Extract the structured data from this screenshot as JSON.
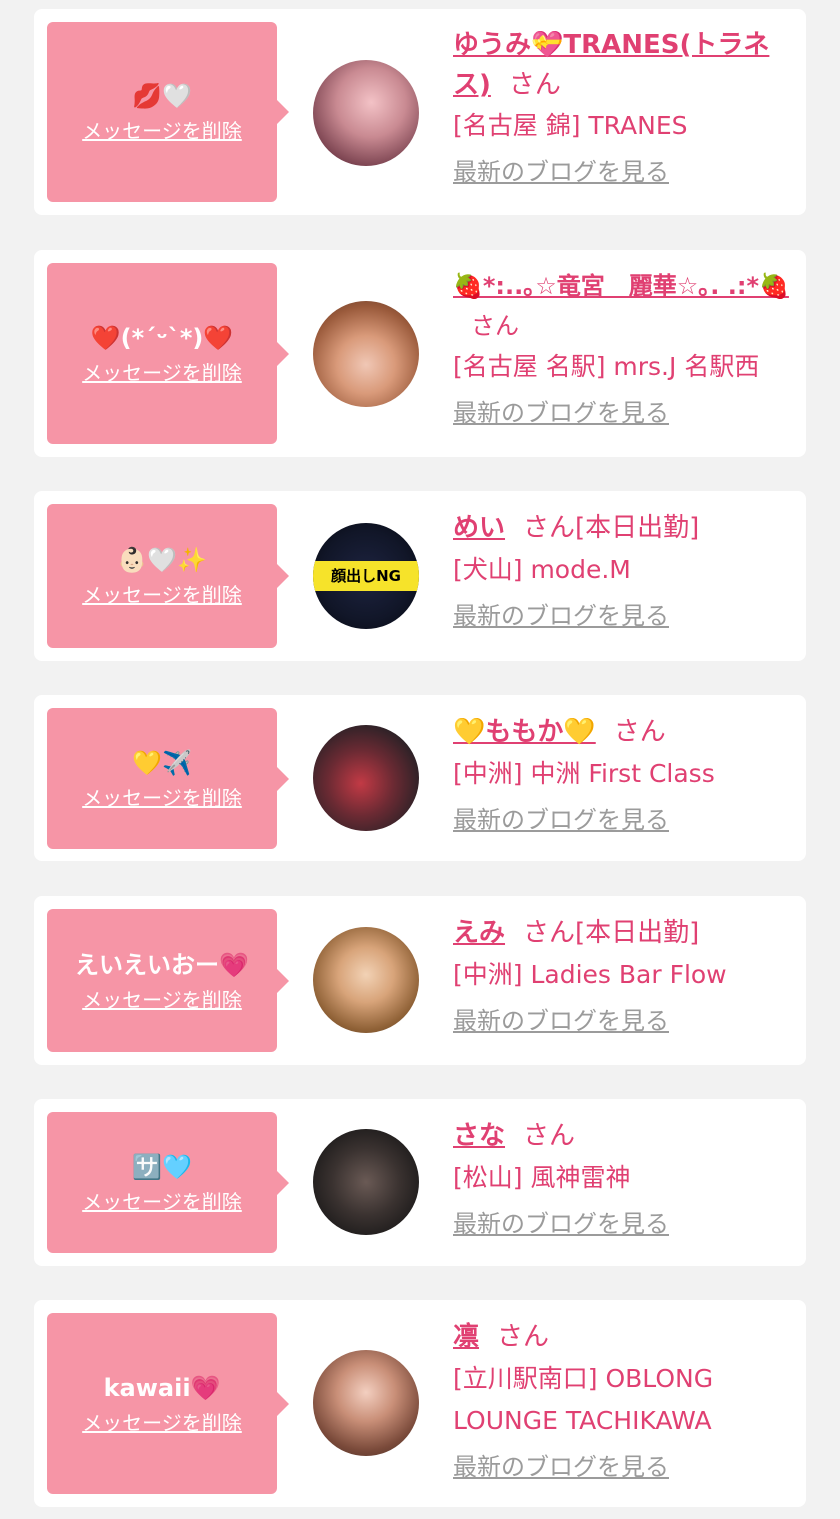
{
  "delete_label": "メッセージを削除",
  "blog_label": "最新のブログを見る",
  "san_label": "さん",
  "cards": [
    {
      "message": "💋🤍",
      "name": "ゆうみ💝TRANES(トラネス)",
      "status": "",
      "shop": "[名古屋 錦] TRANES"
    },
    {
      "message": "❤️(*´ᵕ`*)❤️",
      "name": "🍓*:..｡☆竜宮　麗華☆｡. .:*🍓",
      "status": "",
      "shop": "[名古屋 名駅] mrs.J 名駅西"
    },
    {
      "message": "👶🏻🤍✨",
      "name": "めい",
      "status": "[本日出勤]",
      "shop": "[犬山] mode.M",
      "avatar_text": "顔出しNG"
    },
    {
      "message": "💛✈️",
      "name": "💛ももか💛",
      "status": "",
      "shop": "[中洲] 中洲 First Class"
    },
    {
      "message": "えいえいおー💗",
      "name": "えみ",
      "status": "[本日出勤]",
      "shop": "[中洲] Ladies Bar Flow"
    },
    {
      "message": "🈂️🩵",
      "name": "さな",
      "status": "",
      "shop": "[松山] 風神雷神"
    },
    {
      "message": "kawaii💗",
      "name": "凛",
      "status": "",
      "shop": "[立川駅南口] OBLONG LOUNGE TACHIKAWA"
    }
  ]
}
